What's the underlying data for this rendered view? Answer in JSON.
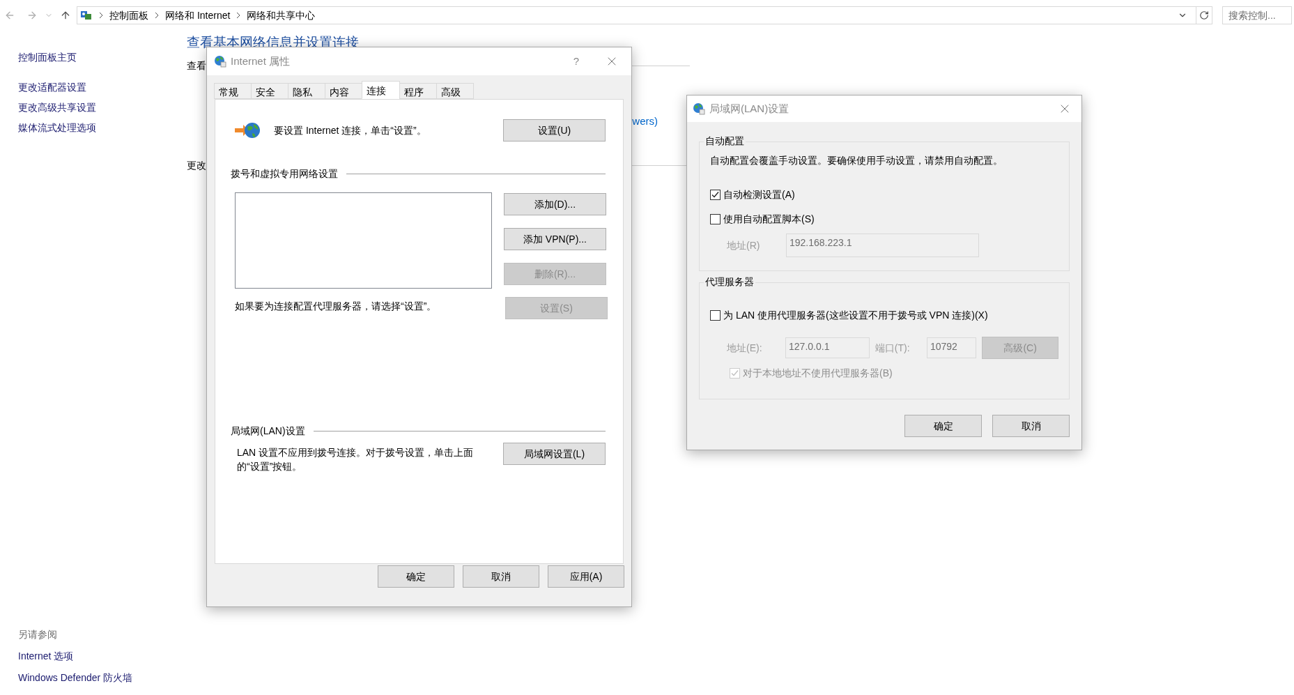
{
  "address_bar": {
    "breadcrumbs": [
      "控制面板",
      "网络和 Internet",
      "网络和共享中心"
    ],
    "search": {
      "placeholder": "搜索控制..."
    }
  },
  "sidebar": {
    "items": [
      "控制面板主页",
      "更改适配器设置",
      "更改高级共享设置",
      "媒体流式处理选项"
    ],
    "see_also": {
      "title": "另请参阅",
      "items": [
        "Internet 选项",
        "Windows Defender 防火墙"
      ]
    }
  },
  "background": {
    "title": "查看基本网络信息并设置连接",
    "section_1": "查看",
    "link_fragment": "wers)",
    "section_2": "更改"
  },
  "internet_properties": {
    "title": "Internet 属性",
    "help_button": "?",
    "tabs": [
      {
        "label": "常规",
        "selected": false
      },
      {
        "label": "安全",
        "selected": false
      },
      {
        "label": "隐私",
        "selected": false
      },
      {
        "label": "内容",
        "selected": false
      },
      {
        "label": "连接",
        "selected": true
      },
      {
        "label": "程序",
        "selected": false
      },
      {
        "label": "高级",
        "selected": false
      }
    ],
    "setup": {
      "text": "要设置 Internet 连接，单击“设置”。",
      "button": {
        "label": "设置(U)",
        "disabled": false
      }
    },
    "dialup": {
      "heading": "拨号和虚拟专用网络设置",
      "buttons": [
        {
          "label": "添加(D)...",
          "disabled": false
        },
        {
          "label": "添加 VPN(P)...",
          "disabled": false
        },
        {
          "label": "删除(R)...",
          "disabled": true
        }
      ],
      "proxy_row": {
        "text": "如果要为连接配置代理服务器，请选择“设置”。",
        "button": {
          "label": "设置(S)",
          "disabled": true
        }
      }
    },
    "lan": {
      "heading": "局域网(LAN)设置",
      "text": "LAN 设置不应用到拨号连接。对于拨号设置，单击上面的“设置”按钮。",
      "button": {
        "label": "局域网设置(L)",
        "disabled": false
      }
    },
    "footer_buttons": [
      {
        "label": "确定",
        "disabled": false
      },
      {
        "label": "取消",
        "disabled": false
      },
      {
        "label": "应用(A)",
        "disabled": false
      }
    ]
  },
  "lan_settings": {
    "title": "局域网(LAN)设置",
    "auto_config": {
      "heading": "自动配置",
      "text": "自动配置会覆盖手动设置。要确保使用手动设置，请禁用自动配置。",
      "options": [
        {
          "label": "自动检测设置(A)",
          "checked": true,
          "disabled": false
        },
        {
          "label": "使用自动配置脚本(S)",
          "checked": false,
          "disabled": false
        }
      ],
      "script_address": {
        "label": "地址(R)",
        "value": "192.168.223.1",
        "disabled": true
      }
    },
    "proxy": {
      "heading": "代理服务器",
      "use_proxy": {
        "label": "为 LAN 使用代理服务器(这些设置不用于拨号或 VPN 连接)(X)",
        "checked": false,
        "disabled": false
      },
      "address": {
        "label": "地址(E):",
        "value": "127.0.0.1",
        "disabled": true
      },
      "port": {
        "label": "端口(T):",
        "value": "10792",
        "disabled": true
      },
      "advanced": {
        "label": "高级(C)",
        "disabled": true
      },
      "bypass_local": {
        "label": "对于本地地址不使用代理服务器(B)",
        "checked": true,
        "disabled": true
      }
    },
    "buttons": [
      {
        "label": "确定",
        "disabled": false
      },
      {
        "label": "取消",
        "disabled": false
      }
    ]
  }
}
